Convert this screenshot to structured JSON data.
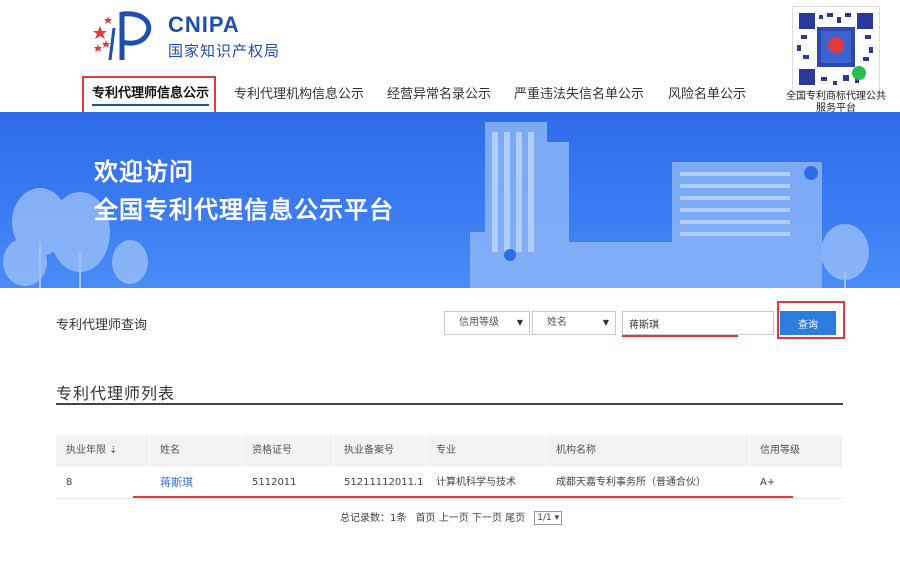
{
  "header": {
    "logo_en": "CNIPA",
    "logo_cn": "国家知识产权局",
    "qr_caption": "全国专利商标代理公共服务平台"
  },
  "nav": {
    "items": [
      {
        "label": "专利代理师信息公示",
        "active": true
      },
      {
        "label": "专利代理机构信息公示",
        "active": false
      },
      {
        "label": "经营异常名录公示",
        "active": false
      },
      {
        "label": "严重违法失信名单公示",
        "active": false
      },
      {
        "label": "风险名单公示",
        "active": false
      }
    ]
  },
  "banner": {
    "line1": "欢迎访问",
    "line2": "全国专利代理信息公示平台"
  },
  "search": {
    "title": "专利代理师查询",
    "select1": "信用等级",
    "select2": "姓名",
    "input_value": "蒋斯琪",
    "button": "查询"
  },
  "list": {
    "title": "专利代理师列表",
    "columns": [
      "执业年限 ⇣",
      "姓名",
      "资格证号",
      "执业备案号",
      "专业",
      "机构名称",
      "信用等级"
    ],
    "rows": [
      [
        "8",
        "蒋斯琪",
        "5112011",
        "51211112011.1",
        "计算机科学与技术",
        "成都天嘉专利事务所（普通合伙）",
        "A+"
      ]
    ]
  },
  "pager": {
    "total": "总记录数：1条",
    "nav": "首页 上一页 下一页 尾页",
    "page": "1/1 ▾"
  },
  "colors": {
    "brand": "#1d4fb3",
    "banner": "#3a7bf2",
    "button": "#2b7de0",
    "highlight": "#e23b3b"
  }
}
